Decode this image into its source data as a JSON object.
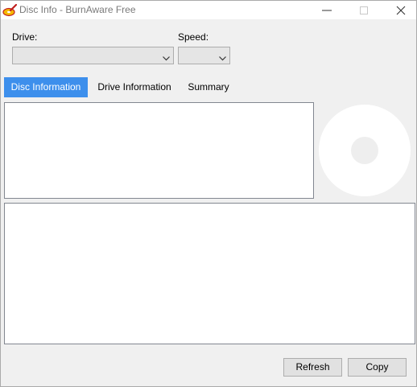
{
  "window": {
    "title": "Disc Info - BurnAware Free",
    "icons": {
      "app": "burnaware-app-icon",
      "minimize": "minimize-icon",
      "maximize": "maximize-icon",
      "close": "close-icon"
    }
  },
  "drive": {
    "label": "Drive:",
    "value": ""
  },
  "speed": {
    "label": "Speed:",
    "value": ""
  },
  "tabs": [
    {
      "label": "Disc Information",
      "active": true
    },
    {
      "label": "Drive Information",
      "active": false
    },
    {
      "label": "Summary",
      "active": false
    }
  ],
  "disc_info_text": "",
  "details_text": "",
  "buttons": {
    "refresh": "Refresh",
    "copy": "Copy"
  },
  "colors": {
    "accent": "#3d8fec",
    "background": "#f0f0f0",
    "disc": "#ffffff",
    "disc_hub": "#eeeeee"
  }
}
